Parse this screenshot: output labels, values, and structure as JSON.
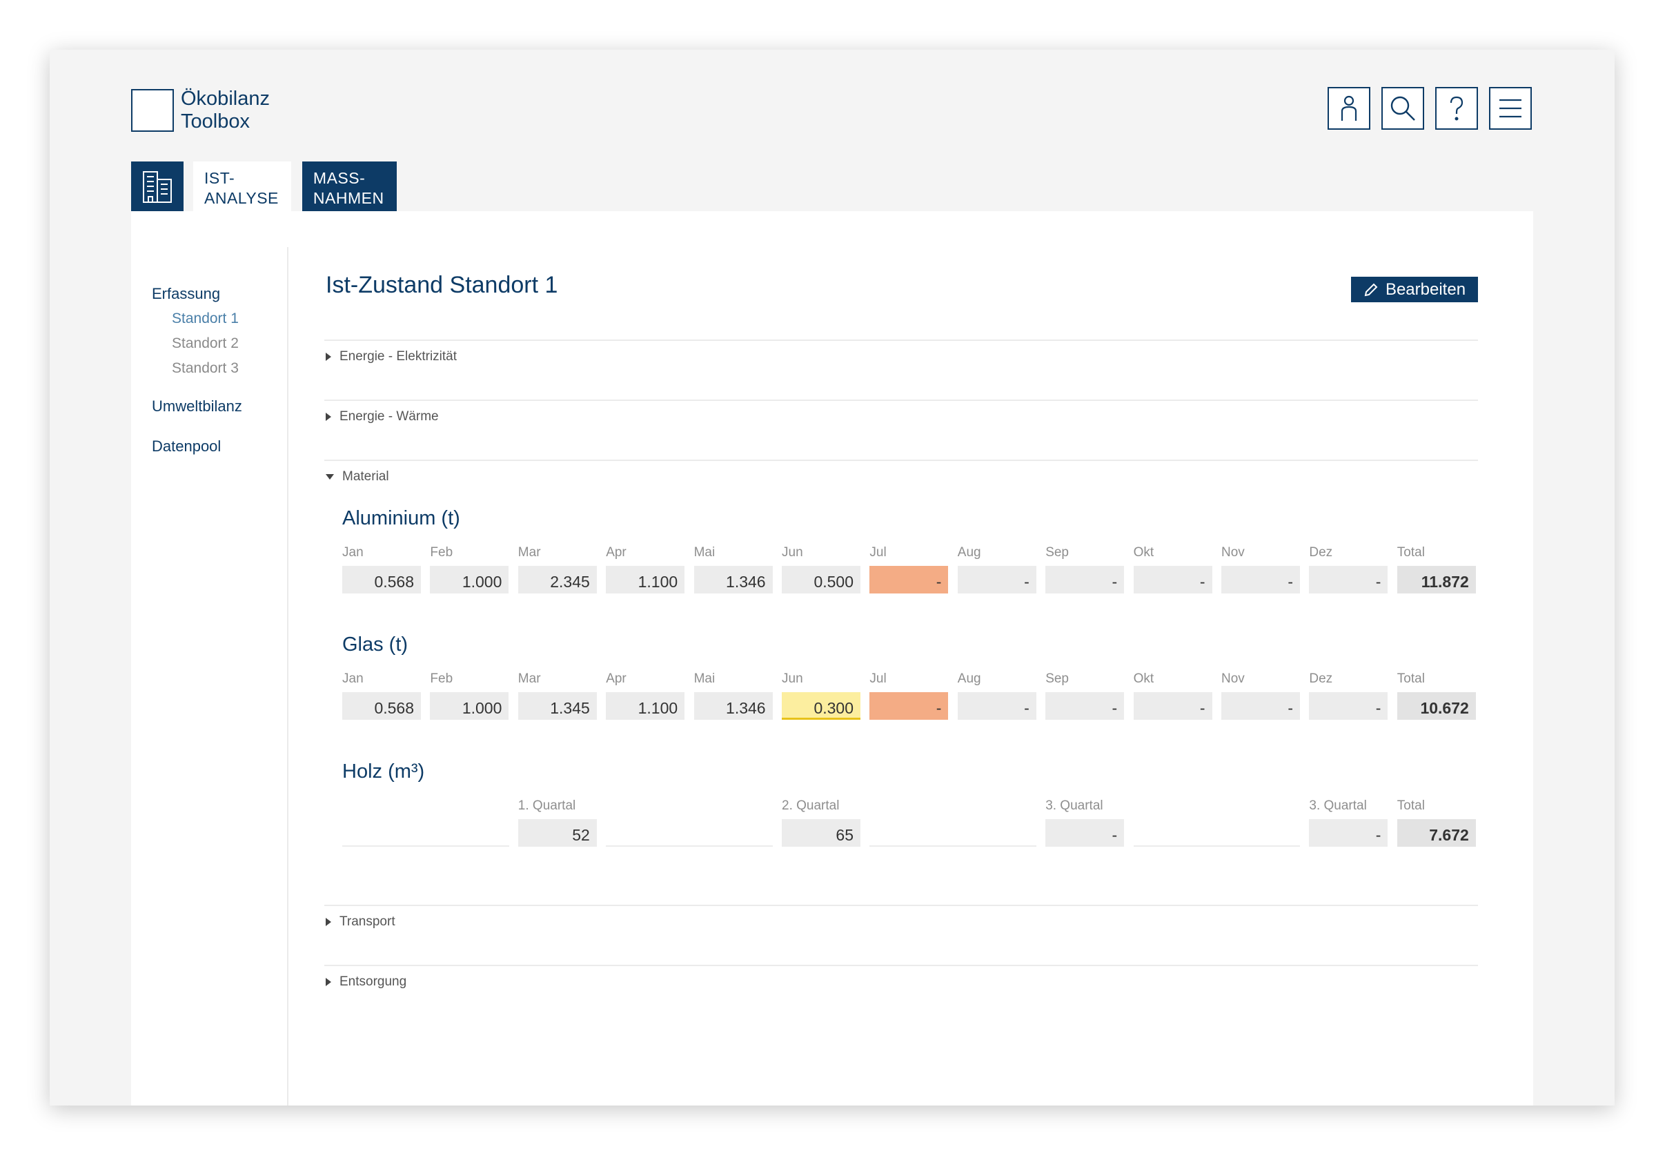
{
  "app": {
    "logo_line1": "Ökobilanz",
    "logo_line2": "Toolbox"
  },
  "header": {
    "icons": [
      "user-icon",
      "search-icon",
      "help-icon",
      "menu-icon"
    ]
  },
  "tabs": {
    "home_icon": "building-icon",
    "ist_line1": "IST-",
    "ist_line2": "ANALYSE",
    "mass_line1": "MASS-",
    "mass_line2": "NAHMEN"
  },
  "sidebar": {
    "erfassung": "Erfassung",
    "standorte": [
      "Standort 1",
      "Standort 2",
      "Standort 3"
    ],
    "umweltbilanz": "Umweltbilanz",
    "datenpool": "Datenpool"
  },
  "main": {
    "title": "Ist-Zustand Standort 1",
    "edit_label": "Bearbeiten",
    "sections": {
      "elektrizitaet": "Energie - Elektrizität",
      "waerme": "Energie - Wärme",
      "material": "Material",
      "transport": "Transport",
      "entsorgung": "Entsorgung"
    }
  },
  "material": {
    "months": [
      "Jan",
      "Feb",
      "Mar",
      "Apr",
      "Mai",
      "Jun",
      "Jul",
      "Aug",
      "Sep",
      "Okt",
      "Nov",
      "Dez",
      "Total"
    ],
    "aluminium": {
      "title": "Aluminium (t)",
      "values": [
        "0.568",
        "1.000",
        "2.345",
        "1.100",
        "1.346",
        "0.500",
        "-",
        "-",
        "-",
        "-",
        "-",
        "-",
        "11.872"
      ]
    },
    "glas": {
      "title": "Glas (t)",
      "values": [
        "0.568",
        "1.000",
        "1.345",
        "1.100",
        "1.346",
        "0.300",
        "-",
        "-",
        "-",
        "-",
        "-",
        "-",
        "10.672"
      ]
    },
    "holz": {
      "title": "Holz (m³)",
      "quarter_labels": [
        "1. Quartal",
        "2. Quartal",
        "3. Quartal",
        "3. Quartal",
        "Total"
      ],
      "quarter_values": [
        "52",
        "65",
        "-",
        "-",
        "7.672"
      ]
    }
  },
  "colors": {
    "primary": "#0d3b66",
    "warning": "#f4ac85",
    "editing": "#fcee9f"
  }
}
